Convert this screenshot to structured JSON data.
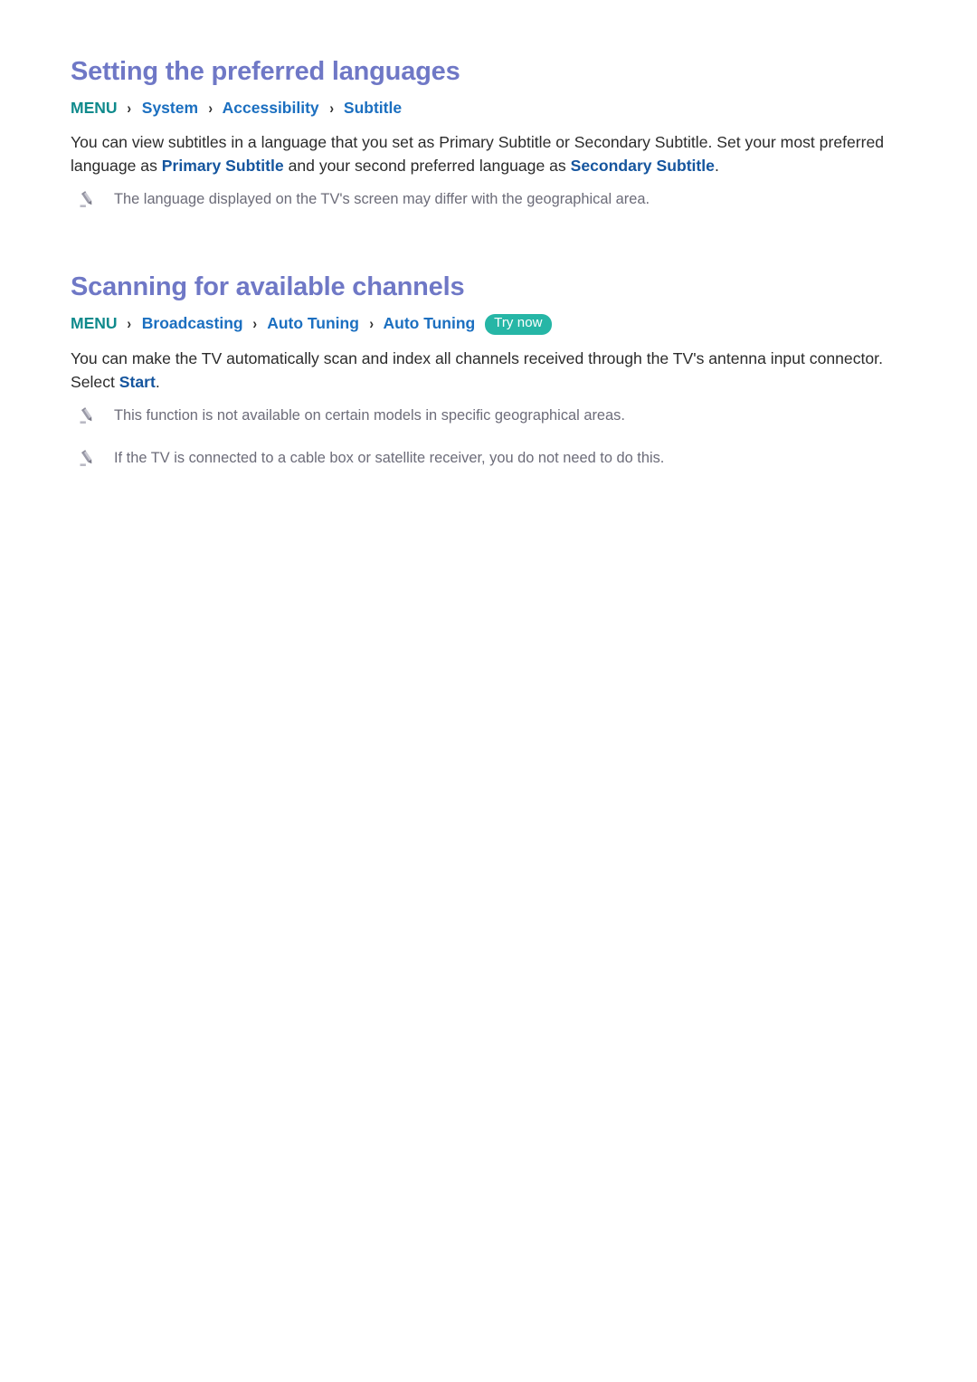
{
  "page": {
    "background": "#ffffff",
    "heading_color": "#6f78c6",
    "breadcrumb_root_color": "#0f8a8c",
    "breadcrumb_item_color": "#1b6fc0",
    "link_color": "#15559e",
    "body_color": "#2b2b2b",
    "note_color": "#6c6c79",
    "badge_color": "#26b6a6"
  },
  "sections": [
    {
      "heading": "Setting the preferred languages",
      "breadcrumb": {
        "root": "MENU",
        "separator": "›",
        "items": [
          "System",
          "Accessibility",
          "Subtitle"
        ],
        "badge": null
      },
      "paragraph": {
        "parts": [
          {
            "text": "You can view subtitles in a language that you set as Primary Subtitle or Secondary Subtitle. Set your most preferred language as ",
            "style": "normal"
          },
          {
            "text": "Primary Subtitle",
            "style": "highlight"
          },
          {
            "text": " and your second preferred language as ",
            "style": "normal"
          },
          {
            "text": "Secondary Subtitle",
            "style": "highlight"
          },
          {
            "text": ".",
            "style": "normal"
          }
        ]
      },
      "notes": [
        {
          "icon": "pencil-icon",
          "text": "The language displayed on the TV's screen may differ with the geographical area."
        }
      ]
    },
    {
      "heading": "Scanning for available channels",
      "breadcrumb": {
        "root": "MENU",
        "separator": "›",
        "items": [
          "Broadcasting",
          "Auto Tuning",
          "Auto Tuning"
        ],
        "badge": "Try now"
      },
      "paragraph": {
        "parts": [
          {
            "text": "You can make the TV automatically scan and index all channels received through the TV's antenna input connector. Select ",
            "style": "normal"
          },
          {
            "text": "Start",
            "style": "highlight"
          },
          {
            "text": ".",
            "style": "normal"
          }
        ]
      },
      "notes": [
        {
          "icon": "pencil-icon",
          "text": "This function is not available on certain models in specific geographical areas."
        },
        {
          "icon": "pencil-icon",
          "text": "If the TV is connected to a cable box or satellite receiver, you do not need to do this."
        }
      ]
    }
  ]
}
